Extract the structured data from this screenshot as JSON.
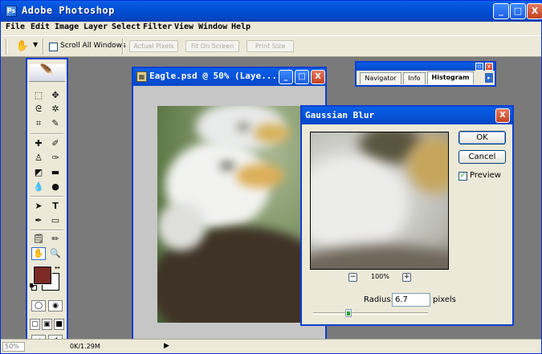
{
  "app": {
    "title": "Adobe Photoshop",
    "title_icon": "Ps"
  },
  "window_controls": {
    "minimize": "_",
    "maximize": "□",
    "close": "X"
  },
  "menu": [
    {
      "label": "File"
    },
    {
      "label": "Edit"
    },
    {
      "label": "Image"
    },
    {
      "label": "Layer"
    },
    {
      "label": "Select"
    },
    {
      "label": "Filter"
    },
    {
      "label": "View"
    },
    {
      "label": "Window"
    },
    {
      "label": "Help"
    }
  ],
  "options_bar": {
    "tool_icon": "hand-icon",
    "scroll_all_windows": "Scroll All Windows",
    "scroll_all_windows_checked": false,
    "actual_pixels": "Actual Pixels",
    "fit_on_screen": "Fit On Screen",
    "print_size": "Print Size"
  },
  "document": {
    "title": "Eagle.psd @ 50% (Laye..."
  },
  "panel": {
    "tabs": [
      "Navigator",
      "Info",
      "Histogram"
    ],
    "active_tab": "Histogram",
    "menu_arrow": "▸"
  },
  "dialog": {
    "title": "Gaussian Blur",
    "ok": "OK",
    "cancel": "Cancel",
    "preview_label": "Preview",
    "preview_checked": true,
    "zoom_out": "−",
    "zoom_in": "+",
    "zoom_level": "100%",
    "radius_label": "Radius:",
    "radius_value": "6.7",
    "radius_unit": "pixels"
  },
  "toolbox": {
    "foreground_color": "#7b2a24",
    "background_color": "#ffffff"
  },
  "status_bar": {
    "zoom": "50%",
    "doc_size": "0K/1.29M",
    "menu_arrow": "▶"
  },
  "colors": {
    "title_bar": "#0350d6",
    "chrome": "#ece9d8",
    "workspace": "#7a7a7a"
  }
}
